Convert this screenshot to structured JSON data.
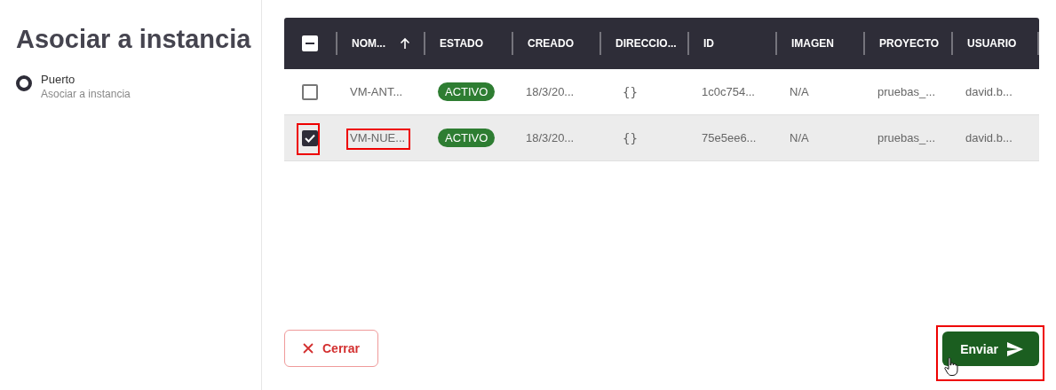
{
  "sidebar": {
    "title": "Asociar a instancia",
    "steps": [
      {
        "label": "Puerto",
        "description": "Asociar a instancia",
        "selected": true
      }
    ]
  },
  "table": {
    "select_all": {
      "indeterminate": true
    },
    "columns": [
      {
        "label": "NOM...",
        "sorted": true
      },
      {
        "label": "ESTADO",
        "sorted": false
      },
      {
        "label": "CREADO",
        "sorted": false
      },
      {
        "label": "DIRECCIO...",
        "sorted": false
      },
      {
        "label": "ID",
        "sorted": false
      },
      {
        "label": "IMAGEN",
        "sorted": false
      },
      {
        "label": "PROYECTO",
        "sorted": false
      },
      {
        "label": "USUARIO",
        "sorted": false
      }
    ],
    "rows": [
      {
        "selected": false,
        "highlighted": false,
        "cells": [
          "VM-ANT...",
          "ACTIVO",
          "18/3/20...",
          "{}",
          "1c0c754...",
          "N/A",
          "pruebas_...",
          "david.b..."
        ],
        "name_highlighted": false
      },
      {
        "selected": true,
        "highlighted": true,
        "cells": [
          "VM-NUE...",
          "ACTIVO",
          "18/3/20...",
          "{}",
          "75e5ee6...",
          "N/A",
          "pruebas_...",
          "david.b..."
        ],
        "name_highlighted": true
      }
    ]
  },
  "buttons": [
    {
      "kind": "close",
      "label": "Cerrar",
      "highlighted": false
    },
    {
      "kind": "send",
      "label": "Enviar",
      "highlighted": true
    }
  ]
}
